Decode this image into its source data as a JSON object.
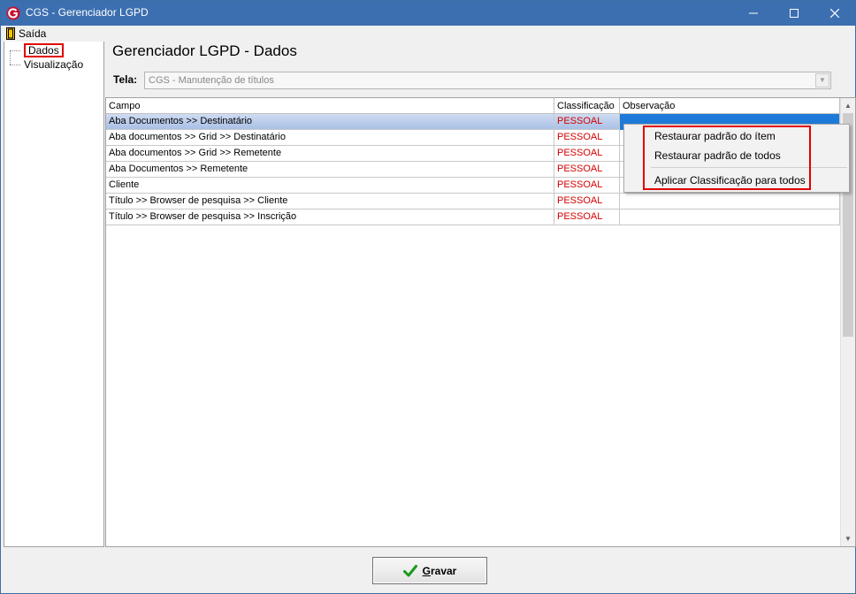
{
  "window": {
    "title": "CGS - Gerenciador LGPD",
    "minimize_label": "–",
    "maximize_label": "☐",
    "close_label": "✕"
  },
  "menubar": {
    "exit_label": "Saída"
  },
  "tree": {
    "items": [
      {
        "label": "Dados"
      },
      {
        "label": "Visualização"
      }
    ]
  },
  "main": {
    "heading": "Gerenciador LGPD - Dados",
    "tela_label": "Tela:",
    "tela_value": "CGS - Manutenção de títulos"
  },
  "grid": {
    "columns": [
      "Campo",
      "Classificação",
      "Observação"
    ],
    "rows": [
      {
        "campo": "Aba Documentos >> Destinatário",
        "classificacao": "PESSOAL",
        "observacao": ""
      },
      {
        "campo": "Aba documentos >> Grid  >> Destinatário",
        "classificacao": "PESSOAL",
        "observacao": ""
      },
      {
        "campo": "Aba documentos >> Grid  >> Remetente",
        "classificacao": "PESSOAL",
        "observacao": ""
      },
      {
        "campo": "Aba Documentos >> Remetente",
        "classificacao": "PESSOAL",
        "observacao": ""
      },
      {
        "campo": "Cliente",
        "classificacao": "PESSOAL",
        "observacao": ""
      },
      {
        "campo": "Título >> Browser de pesquisa >> Cliente",
        "classificacao": "PESSOAL",
        "observacao": ""
      },
      {
        "campo": "Título >> Browser de pesquisa >> Inscrição",
        "classificacao": "PESSOAL",
        "observacao": ""
      }
    ]
  },
  "context_menu": {
    "items": [
      {
        "label": "Restaurar padrão do ítem"
      },
      {
        "label": "Restaurar padrão de todos"
      },
      {
        "label": "Aplicar Classificação para todos"
      }
    ]
  },
  "footer": {
    "gravar_label": "Gravar",
    "gravar_mnemonic": "G",
    "gravar_rest": "ravar"
  },
  "colors": {
    "titlebar": "#3c6fb0",
    "classification_text": "#d40000",
    "highlight_box": "#e00000",
    "selected_cell": "#1e7ad8",
    "check_icon": "#1a9a1a"
  }
}
